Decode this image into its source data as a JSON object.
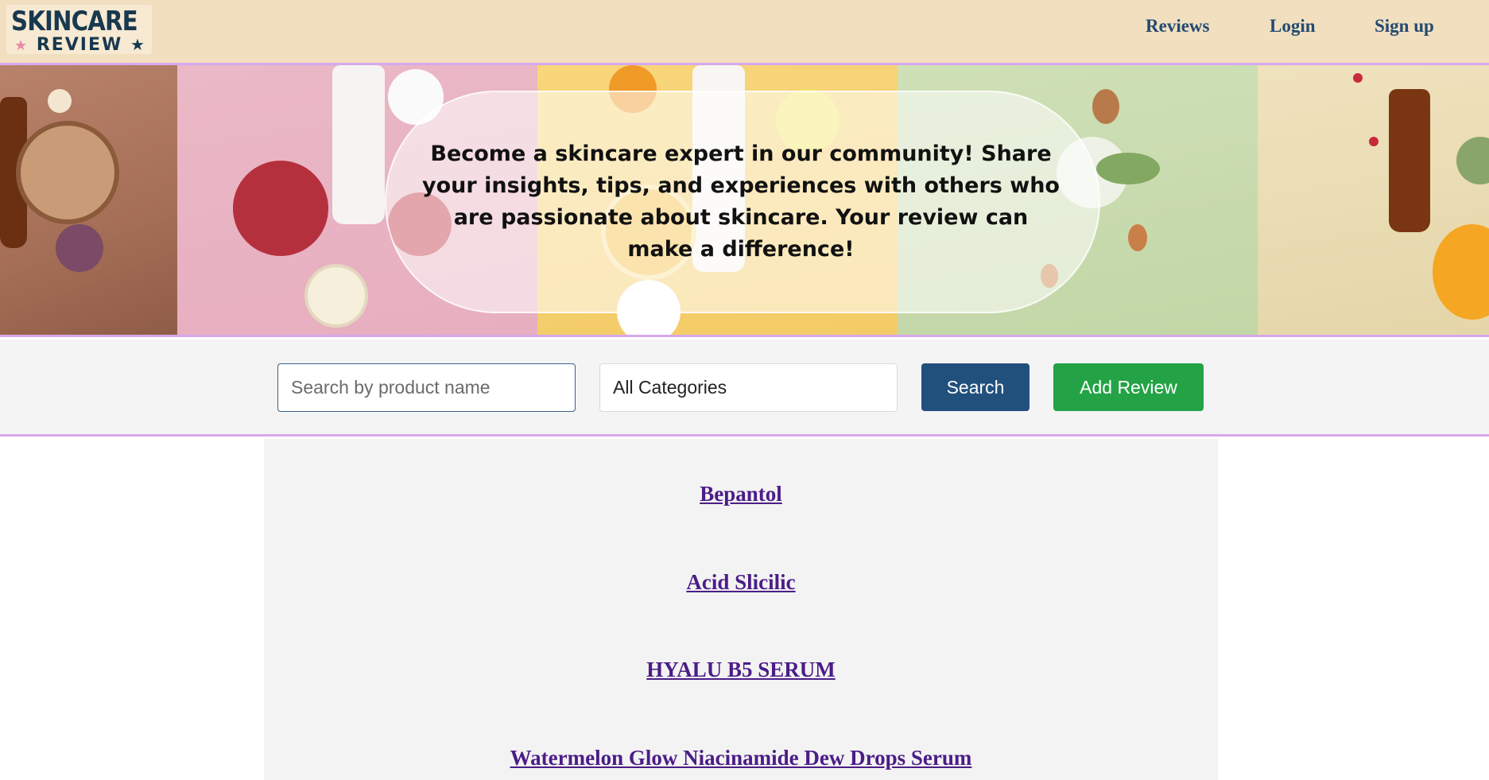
{
  "header": {
    "logo_line1": "SKINCARE",
    "logo_line2": "REVIEW",
    "nav": [
      {
        "label": "Reviews"
      },
      {
        "label": "Login"
      },
      {
        "label": "Sign up"
      }
    ]
  },
  "banner": {
    "message": "Become a skincare expert in our community! Share your insights, tips, and experiences with others who are passionate about skincare. Your review can make a difference!"
  },
  "search": {
    "placeholder": "Search by product name",
    "category_selected": "All Categories",
    "search_label": "Search",
    "add_review_label": "Add Review"
  },
  "products": [
    {
      "name": "Bepantol"
    },
    {
      "name": "Acid Slicilic"
    },
    {
      "name": "HYALU B5 SERUM"
    },
    {
      "name": "Watermelon Glow Niacinamide Dew Drops Serum"
    }
  ],
  "colors": {
    "header_bg": "#f1dfc0",
    "nav_text": "#234b70",
    "accent_border": "#d6a8ec",
    "search_button": "#22507d",
    "add_button": "#23a345",
    "product_link": "#4b1d87"
  },
  "icons": [
    "star-icon"
  ]
}
